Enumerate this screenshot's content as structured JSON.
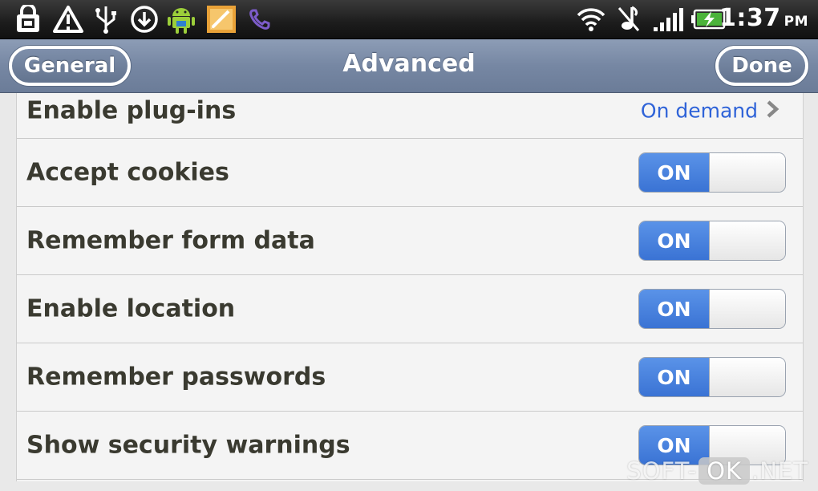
{
  "status_bar": {
    "time": "1:37",
    "ampm": "PM",
    "left_icons": [
      "lock-icon",
      "alert-triangle-icon",
      "usb-icon",
      "download-icon",
      "android-icon",
      "edit-app-icon",
      "viber-icon"
    ],
    "right_icons": [
      "wifi-icon",
      "vibrate-icon",
      "signal-icon",
      "battery-charging-icon"
    ]
  },
  "title_bar": {
    "title": "Advanced",
    "back_label": "General",
    "done_label": "Done"
  },
  "settings": {
    "plugins": {
      "label": "Enable plug-ins",
      "value": "On demand"
    },
    "items": [
      {
        "label": "Accept cookies",
        "toggle": "ON"
      },
      {
        "label": "Remember form data",
        "toggle": "ON"
      },
      {
        "label": "Enable location",
        "toggle": "ON"
      },
      {
        "label": "Remember passwords",
        "toggle": "ON"
      },
      {
        "label": "Show security warnings",
        "toggle": "ON"
      }
    ]
  },
  "watermark": {
    "part1": "SOFT-",
    "part2": "OK",
    "part3": ".NET"
  },
  "colors": {
    "toggle_on": "#3a73d4",
    "link_value": "#2f63d8",
    "title_bar": "#7687a3"
  }
}
